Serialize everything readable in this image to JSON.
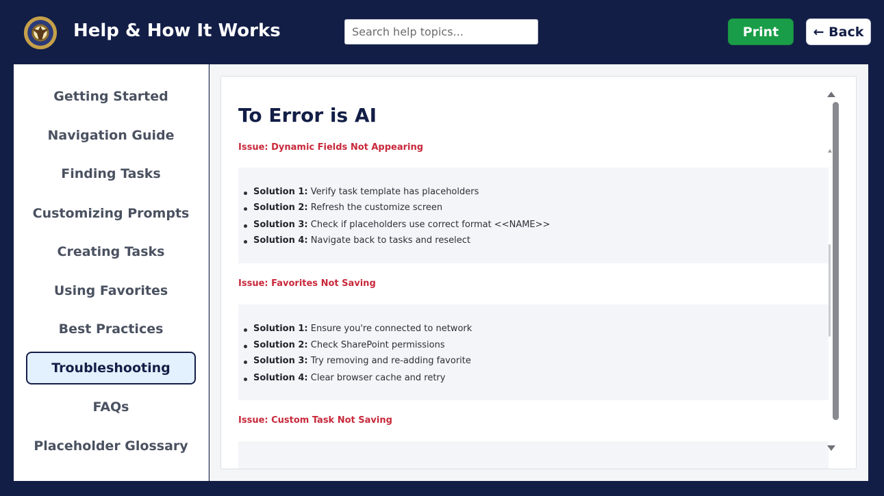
{
  "header": {
    "title": "Help & How It Works",
    "print_label": "Print",
    "back_label": "← Back"
  },
  "search": {
    "placeholder": "Search help topics..."
  },
  "sidebar": {
    "items": [
      {
        "label": "Getting Started",
        "active": false
      },
      {
        "label": "Navigation Guide",
        "active": false
      },
      {
        "label": "Finding Tasks",
        "active": false
      },
      {
        "label": "Customizing Prompts",
        "active": false
      },
      {
        "label": "Creating Tasks",
        "active": false
      },
      {
        "label": "Using Favorites",
        "active": false
      },
      {
        "label": "Best Practices",
        "active": false
      },
      {
        "label": "Troubleshooting",
        "active": true
      },
      {
        "label": "FAQs",
        "active": false
      },
      {
        "label": "Placeholder Glossary",
        "active": false
      }
    ]
  },
  "content": {
    "title": "To Error is AI",
    "issues": [
      {
        "heading": "Issue: Dynamic Fields Not Appearing",
        "solutions": [
          {
            "label": "Solution 1:",
            "text": "Verify task template has placeholders"
          },
          {
            "label": "Solution 2:",
            "text": "Refresh the customize screen"
          },
          {
            "label": "Solution 3:",
            "text": "Check if placeholders use correct format <<NAME>>"
          },
          {
            "label": "Solution 4:",
            "text": "Navigate back to tasks and reselect"
          }
        ]
      },
      {
        "heading": "Issue: Favorites Not Saving",
        "solutions": [
          {
            "label": "Solution 1:",
            "text": "Ensure you're connected to network"
          },
          {
            "label": "Solution 2:",
            "text": "Check SharePoint permissions"
          },
          {
            "label": "Solution 3:",
            "text": "Try removing and re-adding favorite"
          },
          {
            "label": "Solution 4:",
            "text": "Clear browser cache and retry"
          }
        ]
      },
      {
        "heading": "Issue: Custom Task Not Saving",
        "solutions": []
      }
    ]
  },
  "colors": {
    "navy": "#131e47",
    "green": "#1a9d48",
    "issue_red": "#c8283a",
    "active_bg": "#e3f0fd"
  }
}
